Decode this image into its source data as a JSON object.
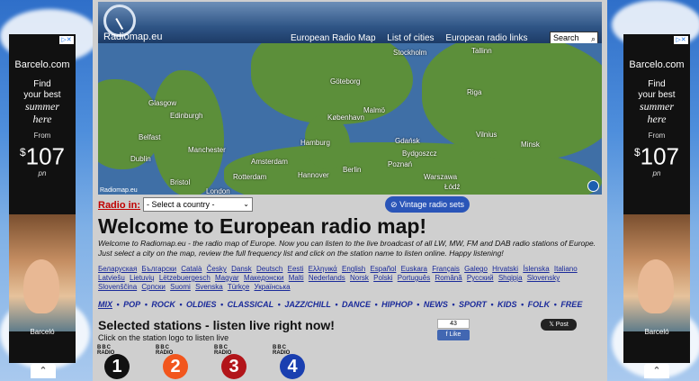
{
  "ads": {
    "left": {
      "brand": "Barcelo.com",
      "tagline_1": "Find",
      "tagline_2": "your best",
      "tagline_3": "summer",
      "tagline_4": "here",
      "from": "From",
      "price": "107",
      "currency": "$",
      "pn": "pn",
      "footer": "Barceló"
    },
    "right": {
      "brand": "Barcelo.com",
      "tagline_1": "Find",
      "tagline_2": "your best",
      "tagline_3": "summer",
      "tagline_4": "here",
      "from": "From",
      "price": "107",
      "currency": "$",
      "pn": "pn",
      "footer": "Barceló"
    }
  },
  "header": {
    "logo_text": "Radiomap.eu",
    "nav": [
      "European Radio Map",
      "List of cities",
      "European radio links"
    ],
    "search_placeholder": "Search"
  },
  "map": {
    "footer": "Radiomap.eu",
    "cities": [
      "Stockholm",
      "Tallinn",
      "Göteborg",
      "Riga",
      "Glasgow",
      "Edinburgh",
      "København",
      "Malmö",
      "Vilnius",
      "Minsk",
      "Hamburg",
      "Gdańsk",
      "Belfast",
      "Dublin",
      "Manchester",
      "Amsterdam",
      "Berlin",
      "Poznań",
      "Warszawa",
      "Bristol",
      "London",
      "Rotterdam",
      "Hannover",
      "Bydgoszcz",
      "Łódź"
    ]
  },
  "controls": {
    "radio_in_label": "Radio in:",
    "country_select": "- Select a country -",
    "vintage_button": "Vintage radio sets"
  },
  "main": {
    "title": "Welcome to European radio map!",
    "intro": "Welcome to Radiomap.eu - the radio map of Europe. Now you can listen to the live broadcast of all LW, MW, FM and DAB radio stations of Europe. Just select a city on the map, review the full frequency list and click on the station name to listen online. Happy listening!",
    "languages": [
      "Беларуская",
      "Български",
      "Català",
      "Česky",
      "Dansk",
      "Deutsch",
      "Eesti",
      "Ελληνικά",
      "English",
      "Español",
      "Euskara",
      "Français",
      "Galego",
      "Hrvatski",
      "Íslenska",
      "Italiano",
      "Latviešu",
      "Lietuvių",
      "Lëtzebuergesch",
      "Magyar",
      "Македонски",
      "Malti",
      "Nederlands",
      "Norsk",
      "Polski",
      "Português",
      "Română",
      "Русский",
      "Shqipja",
      "Slovensky",
      "Slovenščina",
      "Српски",
      "Suomi",
      "Svenska",
      "Türkçe",
      "Українська"
    ],
    "genres": [
      "MIX",
      "POP",
      "ROCK",
      "OLDIES",
      "CLASSICAL",
      "JAZZ/CHILL",
      "DANCE",
      "HIPHOP",
      "NEWS",
      "SPORT",
      "KIDS",
      "FOLK",
      "FREE"
    ],
    "stations_title": "Selected stations - listen live right now!",
    "stations_hint": "Click on the station logo to listen live",
    "fb_count": "43",
    "fb_like": "Like",
    "tweet": "Post",
    "stations": [
      {
        "brand": "BBC",
        "sub": "RADIO",
        "num": "1",
        "color": "#111111"
      },
      {
        "brand": "BBC",
        "sub": "RADIO",
        "num": "2",
        "color": "#f2561d"
      },
      {
        "brand": "BBC",
        "sub": "RADIO",
        "num": "3",
        "color": "#b2151a"
      },
      {
        "brand": "BBC",
        "sub": "RADIO",
        "num": "4",
        "color": "#1a3fb0"
      }
    ]
  }
}
